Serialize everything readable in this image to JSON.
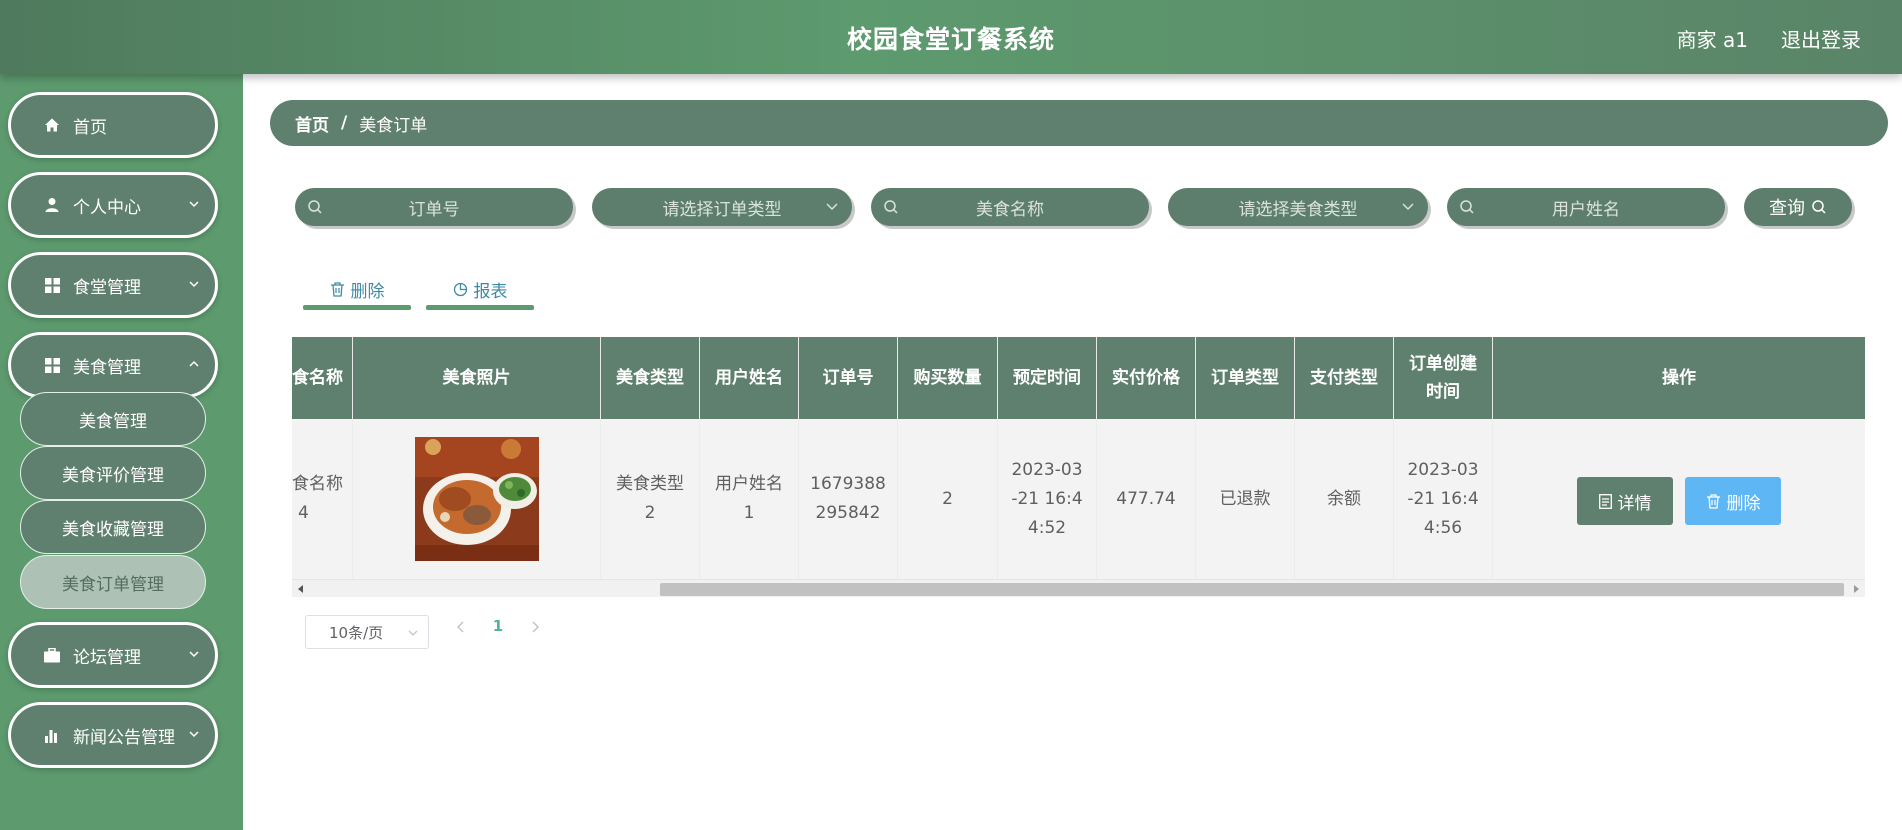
{
  "header": {
    "title": "校园食堂订餐系统",
    "user": "商家 a1",
    "logout": "退出登录"
  },
  "sidebar": {
    "items": [
      {
        "label": "首页",
        "icon": "home-icon"
      },
      {
        "label": "个人中心",
        "icon": "user-icon"
      },
      {
        "label": "食堂管理",
        "icon": "grid-icon"
      },
      {
        "label": "美食管理",
        "icon": "grid-icon"
      },
      {
        "label": "论坛管理",
        "icon": "briefcase-icon"
      },
      {
        "label": "新闻公告管理",
        "icon": "bar-chart-icon"
      }
    ],
    "submenu": [
      "美食管理",
      "美食评价管理",
      "美食收藏管理",
      "美食订单管理"
    ],
    "active_submenu": "美食订单管理"
  },
  "breadcrumb": {
    "home": "首页",
    "separator": "/",
    "current": "美食订单"
  },
  "search": {
    "order_no": "订单号",
    "order_type": "请选择订单类型",
    "food_name": "美食名称",
    "food_type": "请选择美食类型",
    "user_name": "用户姓名",
    "query": "查询"
  },
  "actions": {
    "delete": "删除",
    "report": "报表"
  },
  "table": {
    "columns": [
      "食名称",
      "美食照片",
      "美食类型",
      "用户姓名",
      "订单号",
      "购买数量",
      "预定时间",
      "实付价格",
      "订单类型",
      "支付类型",
      "订单创建时间",
      "操作"
    ],
    "header_lines": {
      "created_1": "订单创建",
      "created_2": "时间"
    },
    "row": {
      "food_name_1": "食名称",
      "food_name_2": "4",
      "food_type_1": "美食类型",
      "food_type_2": "2",
      "user_name_1": "用户姓名",
      "user_name_2": "1",
      "order_no_1": "1679388",
      "order_no_2": "295842",
      "quantity": "2",
      "reserve_1": "2023-03",
      "reserve_2": "-21 16:4",
      "reserve_3": "4:52",
      "price": "477.74",
      "order_type": "已退款",
      "pay_type": "余额",
      "created_1": "2023-03",
      "created_2": "-21 16:4",
      "created_3": "4:56",
      "detail_btn": "详情",
      "delete_btn": "删除"
    }
  },
  "pagination": {
    "page_size": "10条/页",
    "current_page": "1"
  },
  "colors": {
    "header": "#5d9a6e",
    "panel": "#60806f",
    "accent_blue": "#5fb6f5",
    "active_page": "#4fb3a0"
  }
}
